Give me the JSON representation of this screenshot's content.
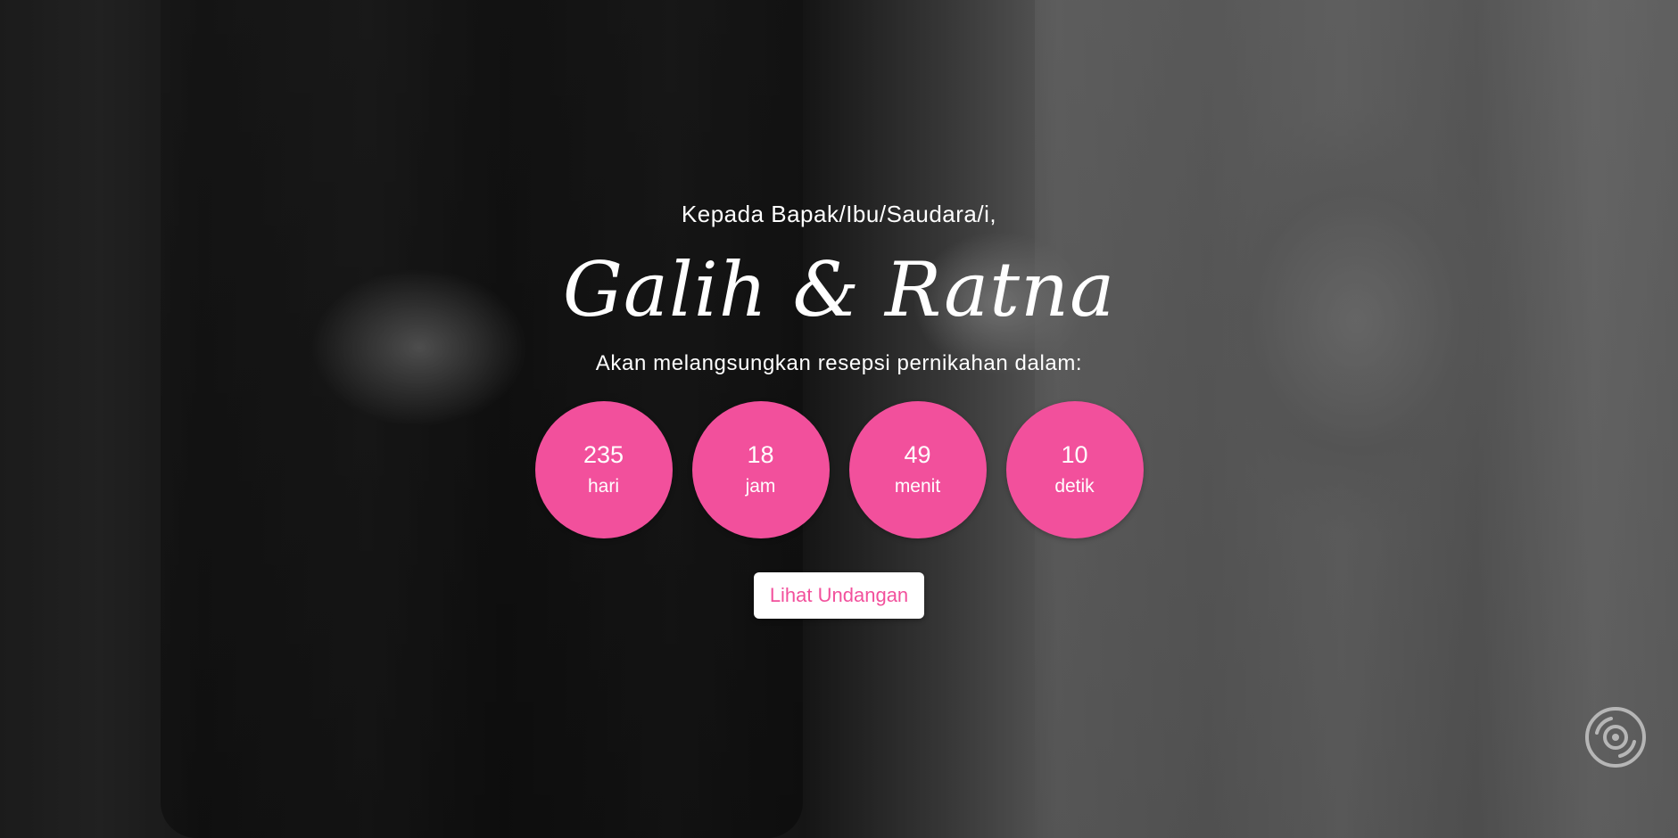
{
  "hero": {
    "greeting": "Kepada Bapak/Ibu/Saudara/i,",
    "couple_names": "Galih & Ratna",
    "subtitle": "Akan melangsungkan resepsi pernikahan dalam:"
  },
  "countdown": [
    {
      "value": "235",
      "unit": "hari"
    },
    {
      "value": "18",
      "unit": "jam"
    },
    {
      "value": "49",
      "unit": "menit"
    },
    {
      "value": "10",
      "unit": "detik"
    }
  ],
  "cta": {
    "label": "Lihat Undangan"
  },
  "music_button": {
    "icon": "music-disc-icon"
  },
  "colors": {
    "accent": "#f2509c",
    "button_bg": "#ffffff",
    "text": "#ffffff"
  }
}
